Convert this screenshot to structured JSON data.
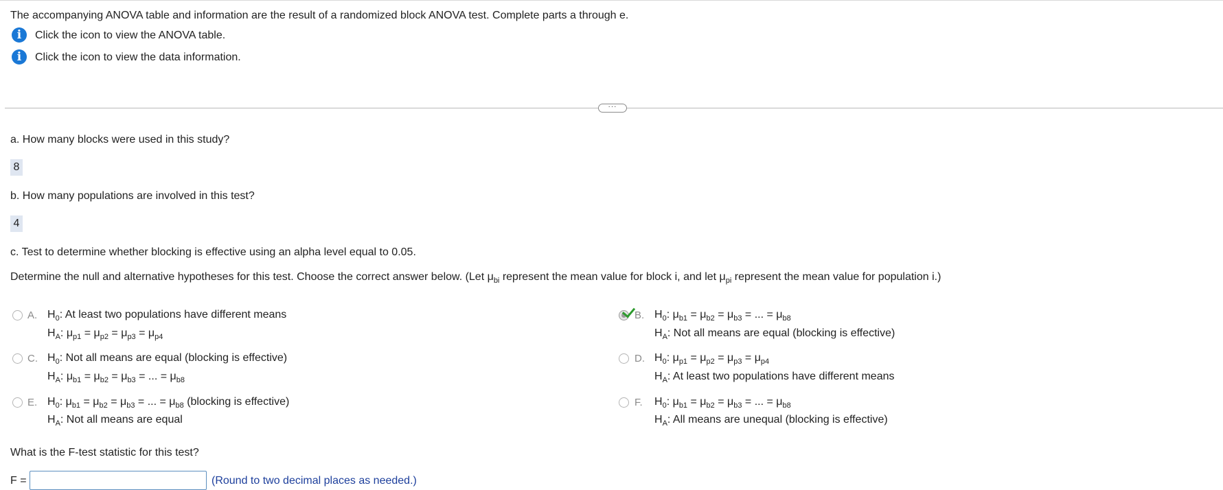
{
  "intro": "The accompanying ANOVA table and information are the result of a randomized block ANOVA test. Complete parts a through e.",
  "info_links": [
    {
      "icon": "info-icon",
      "text": "Click the icon to view the ANOVA table."
    },
    {
      "icon": "info-icon",
      "text": "Click the icon to view the data information."
    }
  ],
  "expander_label": "···",
  "part_a": {
    "question": "a. How many blocks were used in this study?",
    "answer": "8"
  },
  "part_b": {
    "question": "b. How many populations are involved in this test?",
    "answer": "4"
  },
  "part_c": {
    "question": "c. Test to determine whether blocking is effective using an alpha level equal to 0.05.",
    "instruction": {
      "t1": "Determine the null and alternative hypotheses for this test. Choose the correct answer below. (Let μ",
      "s1": "bi",
      "t2": " represent the mean value for block i, and let μ",
      "s2": "pi",
      "t3": " represent the mean value for population i.)"
    }
  },
  "hyp": {
    "H": "H",
    "zero": "0",
    "A": "A",
    "colon": ":",
    "mu": "μ",
    "eq": " = ",
    "ellipsis": " = ... = ",
    "p1": "p1",
    "p2": "p2",
    "p3": "p3",
    "p4": "p4",
    "b1": "b1",
    "b2": "b2",
    "b3": "b3",
    "b8": "b8"
  },
  "options": [
    {
      "letter": "A.",
      "selected": false,
      "h0_text": " At least two populations have different means",
      "ha_text": ""
    },
    {
      "letter": "B.",
      "selected": true,
      "h0_text": "",
      "ha_text": " Not all means are equal (blocking is effective)"
    },
    {
      "letter": "C.",
      "selected": false,
      "h0_text": " Not all means are equal (blocking is effective)",
      "ha_text": ""
    },
    {
      "letter": "D.",
      "selected": false,
      "h0_text": "",
      "ha_text": " At least two populations have different means"
    },
    {
      "letter": "E.",
      "selected": false,
      "h0_text": " (blocking is effective)",
      "ha_text": " Not all means are equal"
    },
    {
      "letter": "F.",
      "selected": false,
      "h0_text": "",
      "ha_text": " All means are unequal (blocking is effective)"
    }
  ],
  "f_question": "What is the F-test statistic for this test?",
  "f_label": "F =",
  "f_value": "",
  "f_hint": "(Round to two decimal places as needed.)",
  "colors": {
    "info": "#1a78d6",
    "check": "#2d9a2d",
    "answer_bg": "#dfe6f1",
    "hint": "#1d3f9c"
  }
}
